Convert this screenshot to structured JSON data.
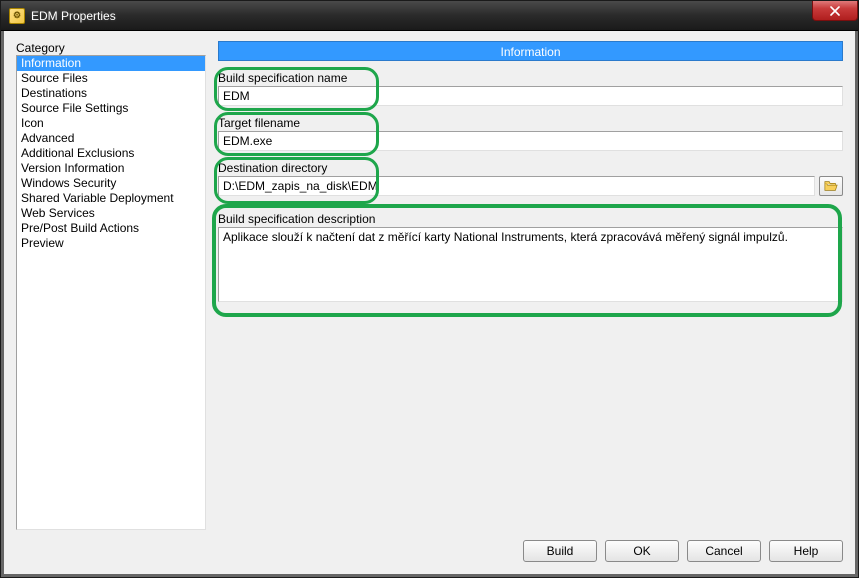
{
  "window": {
    "title": "EDM Properties"
  },
  "category": {
    "header": "Category",
    "items": [
      "Information",
      "Source Files",
      "Destinations",
      "Source File Settings",
      "Icon",
      "Advanced",
      "Additional Exclusions",
      "Version Information",
      "Windows Security",
      "Shared Variable Deployment",
      "Web Services",
      "Pre/Post Build Actions",
      "Preview"
    ],
    "selected_index": 0
  },
  "panel": {
    "header": "Information",
    "build_spec_name_label": "Build specification name",
    "build_spec_name_value": "EDM",
    "target_filename_label": "Target filename",
    "target_filename_value": "EDM.exe",
    "dest_dir_label": "Destination directory",
    "dest_dir_value": "D:\\EDM_zapis_na_disk\\EDM",
    "description_label": "Build specification description",
    "description_value": "Aplikace slouží k načtení dat z měřící karty National Instruments, která zpracovává měřený signál impulzů."
  },
  "buttons": {
    "build": "Build",
    "ok": "OK",
    "cancel": "Cancel",
    "help": "Help"
  }
}
